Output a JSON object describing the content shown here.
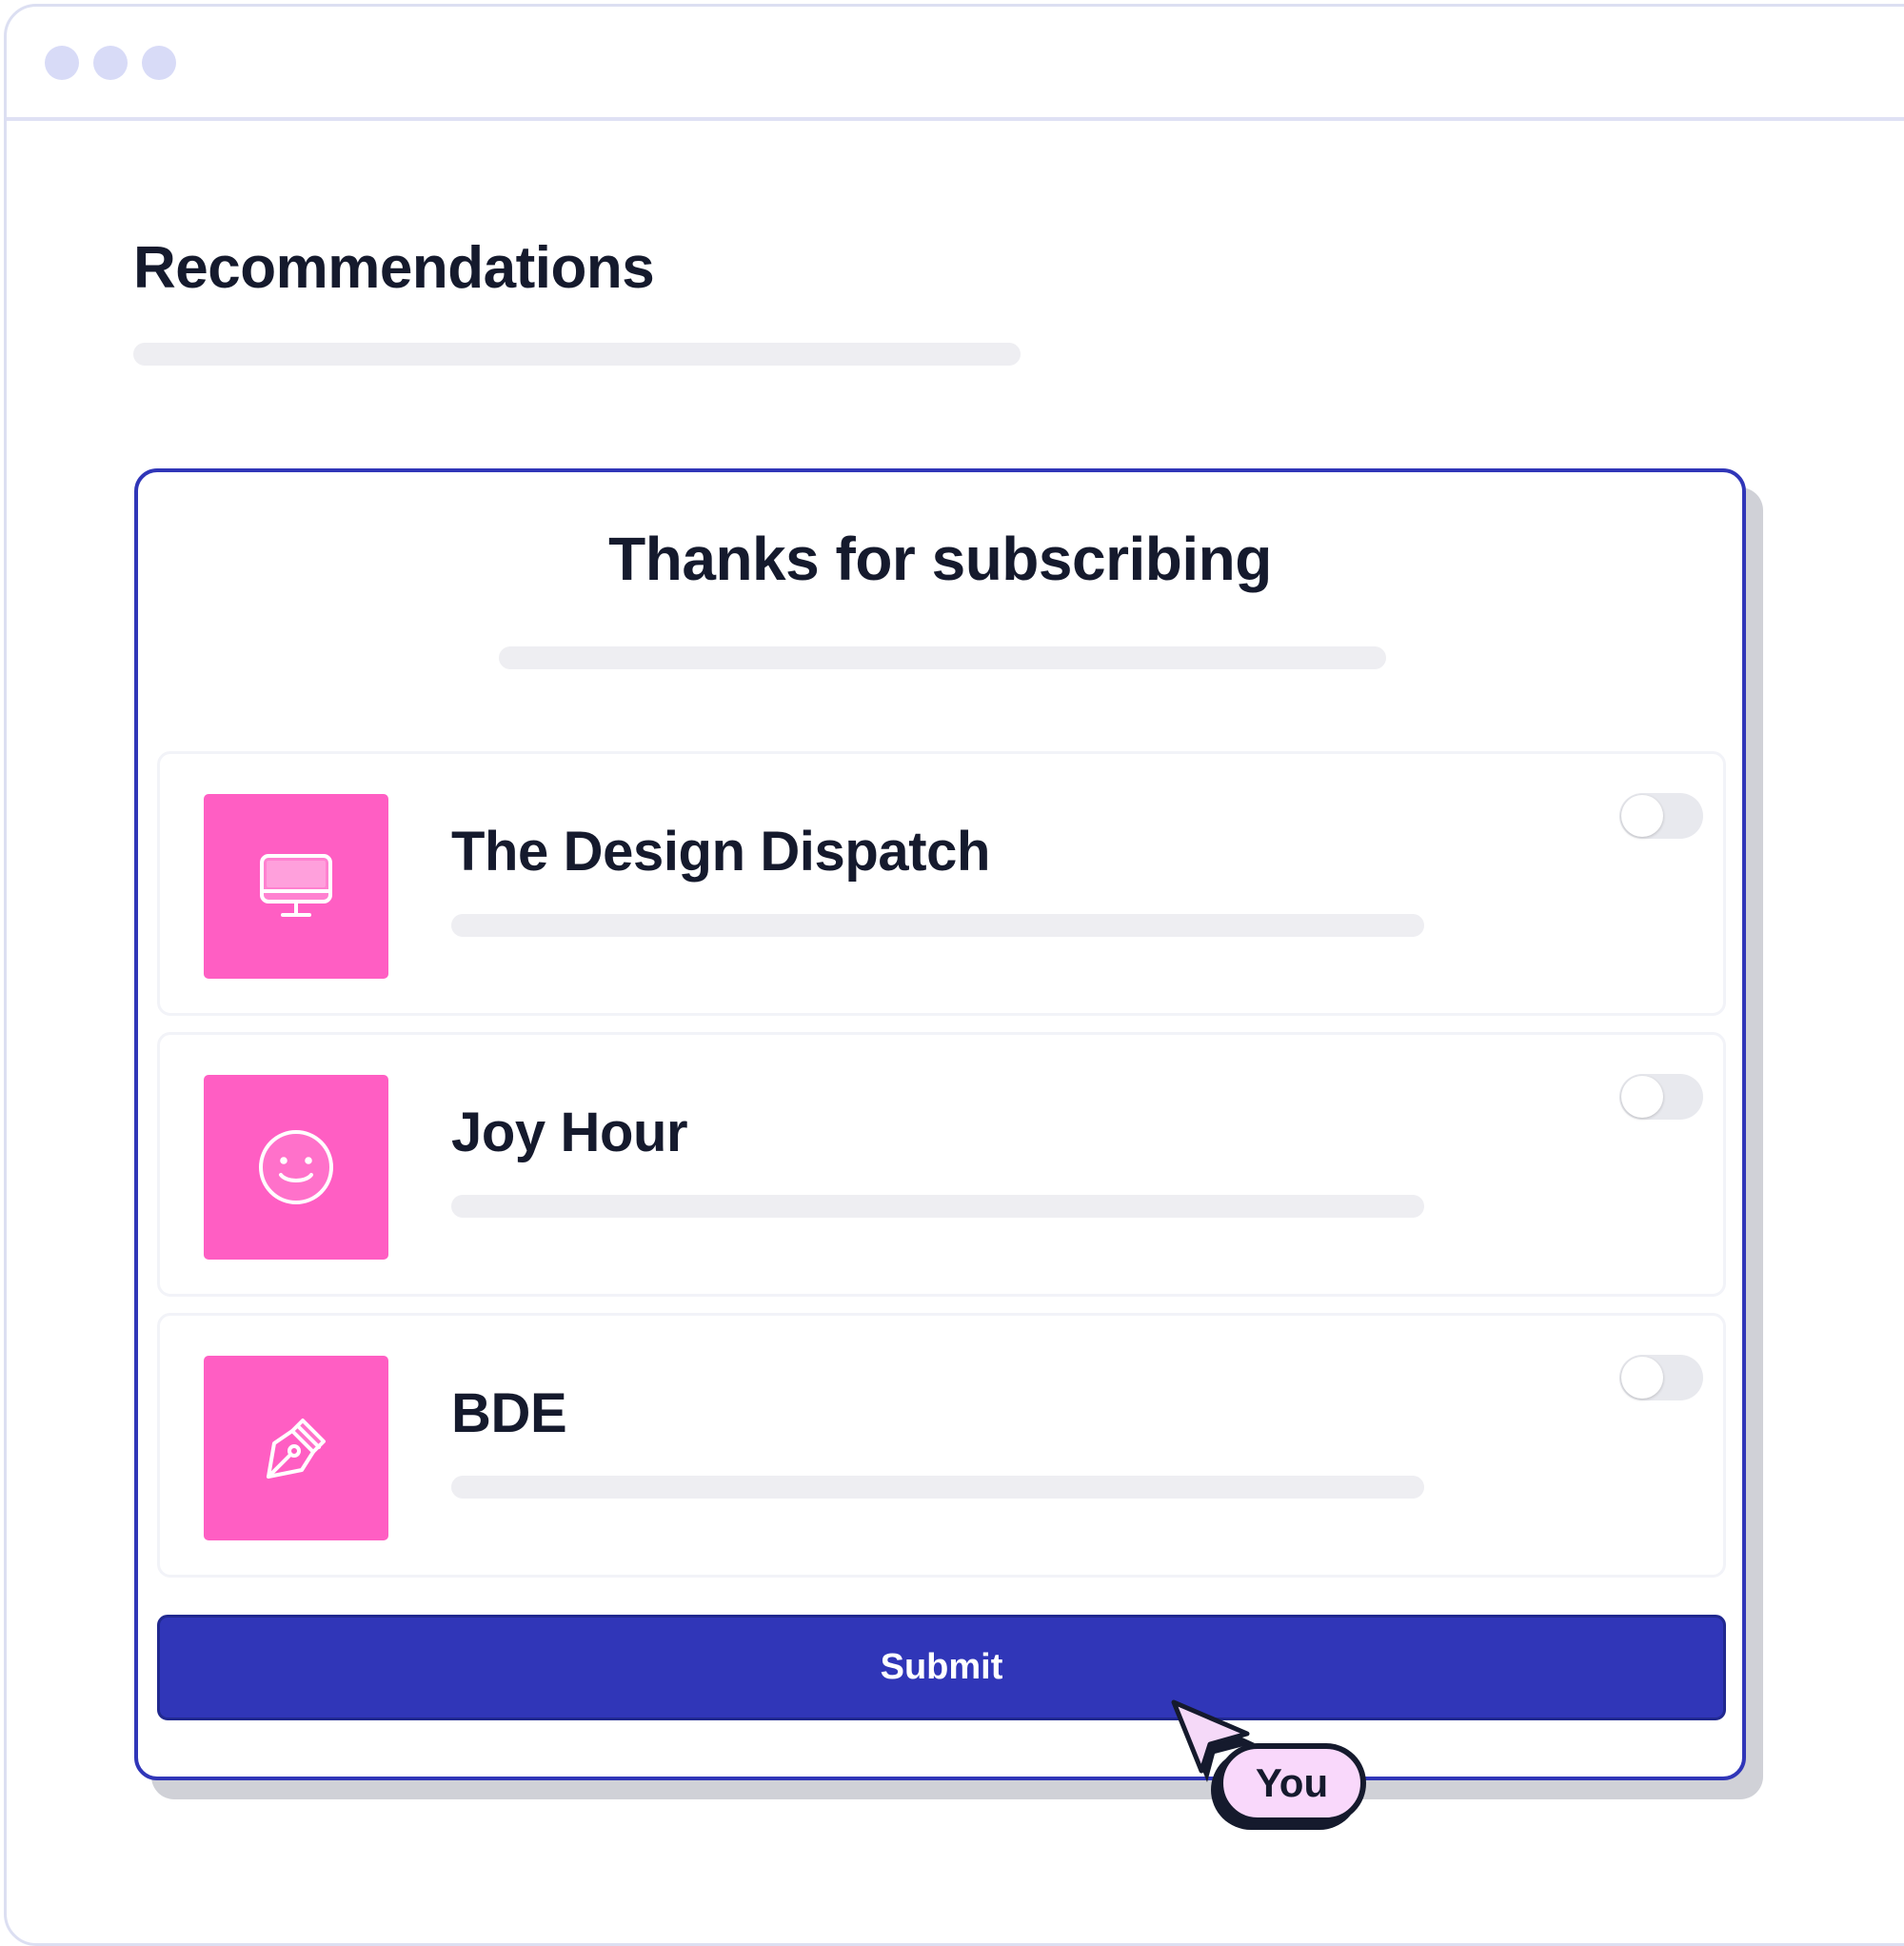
{
  "window": {
    "dot_colors": [
      "#d8dbf7",
      "#d8dbf7",
      "#d8dbf7"
    ],
    "border_color": "#dcdff2"
  },
  "page": {
    "title": "Recommendations",
    "placeholder_color": "#eeeef2"
  },
  "modal": {
    "title": "Thanks for subscribing",
    "border_color": "#3036b8",
    "shadow_color": "#d0d1d7",
    "items": [
      {
        "title": "The Design Dispatch",
        "icon": "monitor-icon",
        "tile_color": "#ff5ec3",
        "enabled": false
      },
      {
        "title": "Joy Hour",
        "icon": "smile-icon",
        "tile_color": "#ff5ec3",
        "enabled": false
      },
      {
        "title": "BDE",
        "icon": "pen-nib-icon",
        "tile_color": "#ff5ec3",
        "enabled": false
      }
    ],
    "toggle_off_color": "#e8e9ee",
    "submit_label": "Submit",
    "submit_color": "#3036b8"
  },
  "pointer": {
    "icon": "cursor-arrow-icon",
    "badge_label": "You",
    "badge_color": "#f9d8fb",
    "arrow_color": "#f5d9f8"
  }
}
